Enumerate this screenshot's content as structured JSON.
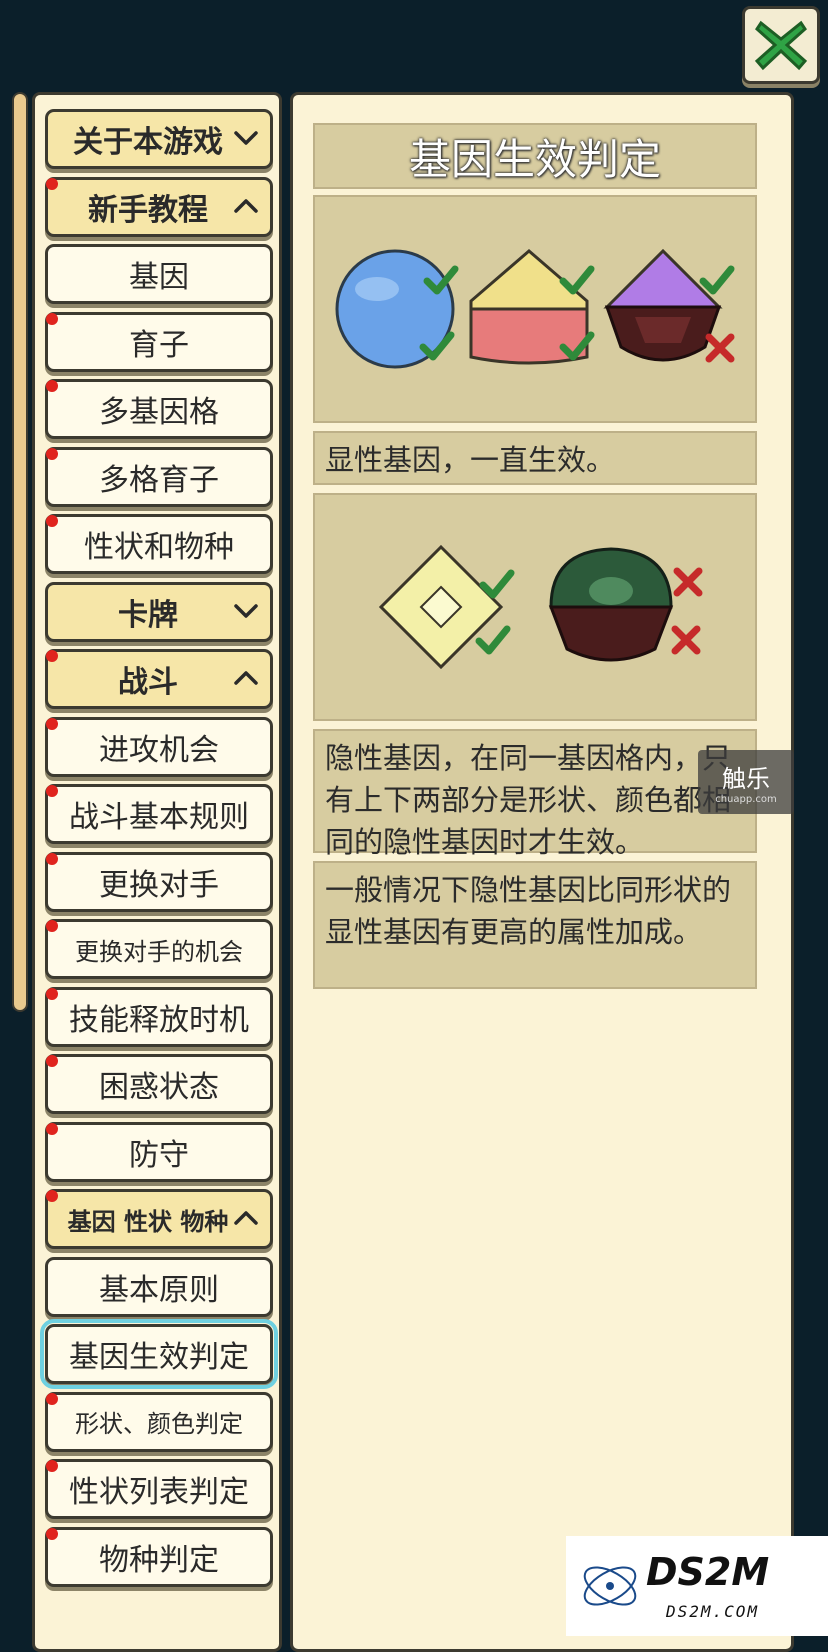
{
  "close_button": {
    "icon": "close-icon"
  },
  "sidebar": {
    "items": [
      {
        "label": "关于本游戏",
        "type": "section",
        "state": "collapsed",
        "dot": false
      },
      {
        "label": "新手教程",
        "type": "section",
        "state": "expanded",
        "dot": true
      },
      {
        "label": "基因",
        "type": "page",
        "dot": false
      },
      {
        "label": "育子",
        "type": "page",
        "dot": true
      },
      {
        "label": "多基因格",
        "type": "page",
        "dot": true
      },
      {
        "label": "多格育子",
        "type": "page",
        "dot": true
      },
      {
        "label": "性状和物种",
        "type": "page",
        "dot": true
      },
      {
        "label": "卡牌",
        "type": "section",
        "state": "collapsed",
        "dot": false
      },
      {
        "label": "战斗",
        "type": "section",
        "state": "expanded",
        "dot": true
      },
      {
        "label": "进攻机会",
        "type": "page",
        "dot": true
      },
      {
        "label": "战斗基本规则",
        "type": "page",
        "dot": true
      },
      {
        "label": "更换对手",
        "type": "page",
        "dot": true
      },
      {
        "label": "更换对手的机会",
        "type": "page",
        "dot": true
      },
      {
        "label": "技能释放时机",
        "type": "page",
        "dot": true
      },
      {
        "label": "困惑状态",
        "type": "page",
        "dot": true
      },
      {
        "label": "防守",
        "type": "page",
        "dot": true
      },
      {
        "label": "基因 性状 物种",
        "type": "section",
        "state": "expanded",
        "dot": true
      },
      {
        "label": "基本原则",
        "type": "page",
        "dot": false
      },
      {
        "label": "基因生效判定",
        "type": "page",
        "dot": false,
        "selected": true
      },
      {
        "label": "形状、颜色判定",
        "type": "page",
        "dot": true
      },
      {
        "label": "性状列表判定",
        "type": "page",
        "dot": true
      },
      {
        "label": "物种判定",
        "type": "page",
        "dot": true
      }
    ]
  },
  "main": {
    "title": "基因生效判定",
    "caption1": "显性基因，一直生效。",
    "caption2": "隐性基因，在同一基因格内，只有上下两部分是形状、颜色都相同的隐性基因时才生效。",
    "caption3": "一般情况下隐性基因比同形状的显性基因有更高的属性加成。"
  },
  "watermarks": {
    "chule_big": "触乐",
    "chule_small": "chuapp.com",
    "ds2m_big": "DS2M",
    "ds2m_small": "DS2M.COM"
  },
  "colors": {
    "background": "#0b1f2a",
    "panel": "#fbf3d6",
    "section": "#f6e6a8",
    "selected_outline": "#6fd0e0",
    "dot": "#e0241e"
  }
}
